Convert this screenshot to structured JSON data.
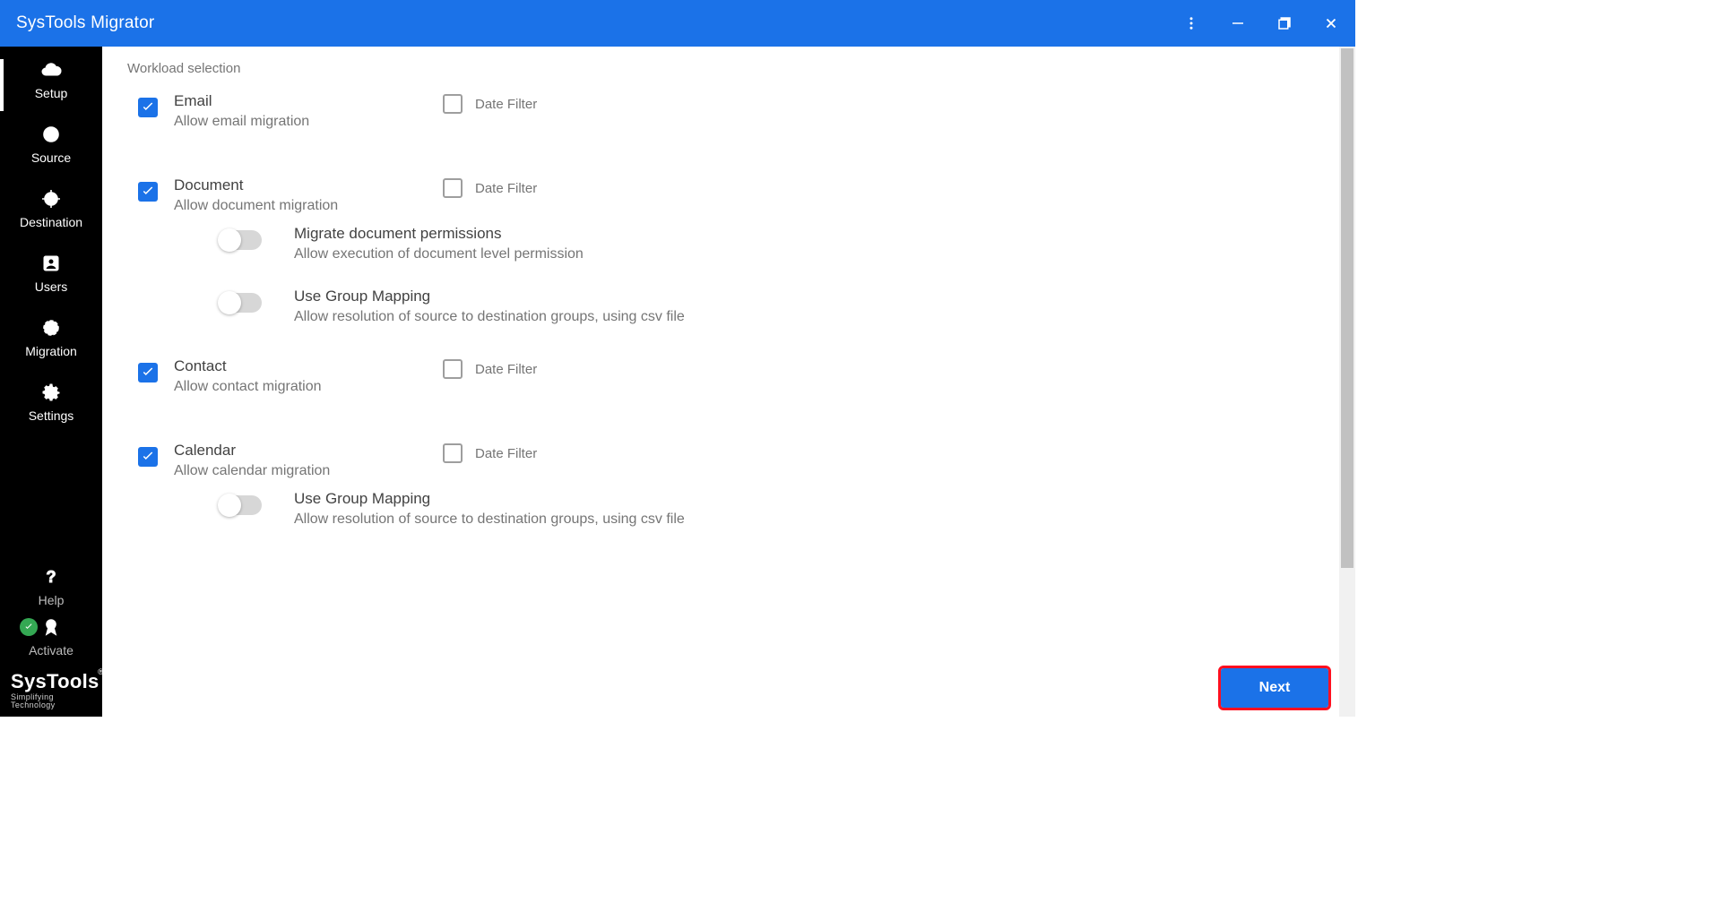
{
  "app_title": "SysTools Migrator",
  "sidebar": {
    "items": [
      {
        "label": "Setup"
      },
      {
        "label": "Source"
      },
      {
        "label": "Destination"
      },
      {
        "label": "Users"
      },
      {
        "label": "Migration"
      },
      {
        "label": "Settings"
      }
    ],
    "help": "Help",
    "activate": "Activate",
    "footer_top": "SysTools",
    "footer_reg": "®",
    "footer_bottom": "Simplifying Technology"
  },
  "section_title": "Workload selection",
  "date_filter_label": "Date Filter",
  "workloads": [
    {
      "title": "Email",
      "desc": "Allow email migration"
    },
    {
      "title": "Document",
      "desc": "Allow document migration"
    },
    {
      "title": "Contact",
      "desc": "Allow contact migration"
    },
    {
      "title": "Calendar",
      "desc": "Allow calendar migration"
    }
  ],
  "doc_subopts": [
    {
      "title": "Migrate document permissions",
      "desc": "Allow execution of document level permission"
    },
    {
      "title": "Use Group Mapping",
      "desc": "Allow resolution of source to destination groups, using csv file"
    }
  ],
  "cal_subopts": [
    {
      "title": "Use Group Mapping",
      "desc": "Allow resolution of source to destination groups, using csv file"
    }
  ],
  "next_label": "Next"
}
